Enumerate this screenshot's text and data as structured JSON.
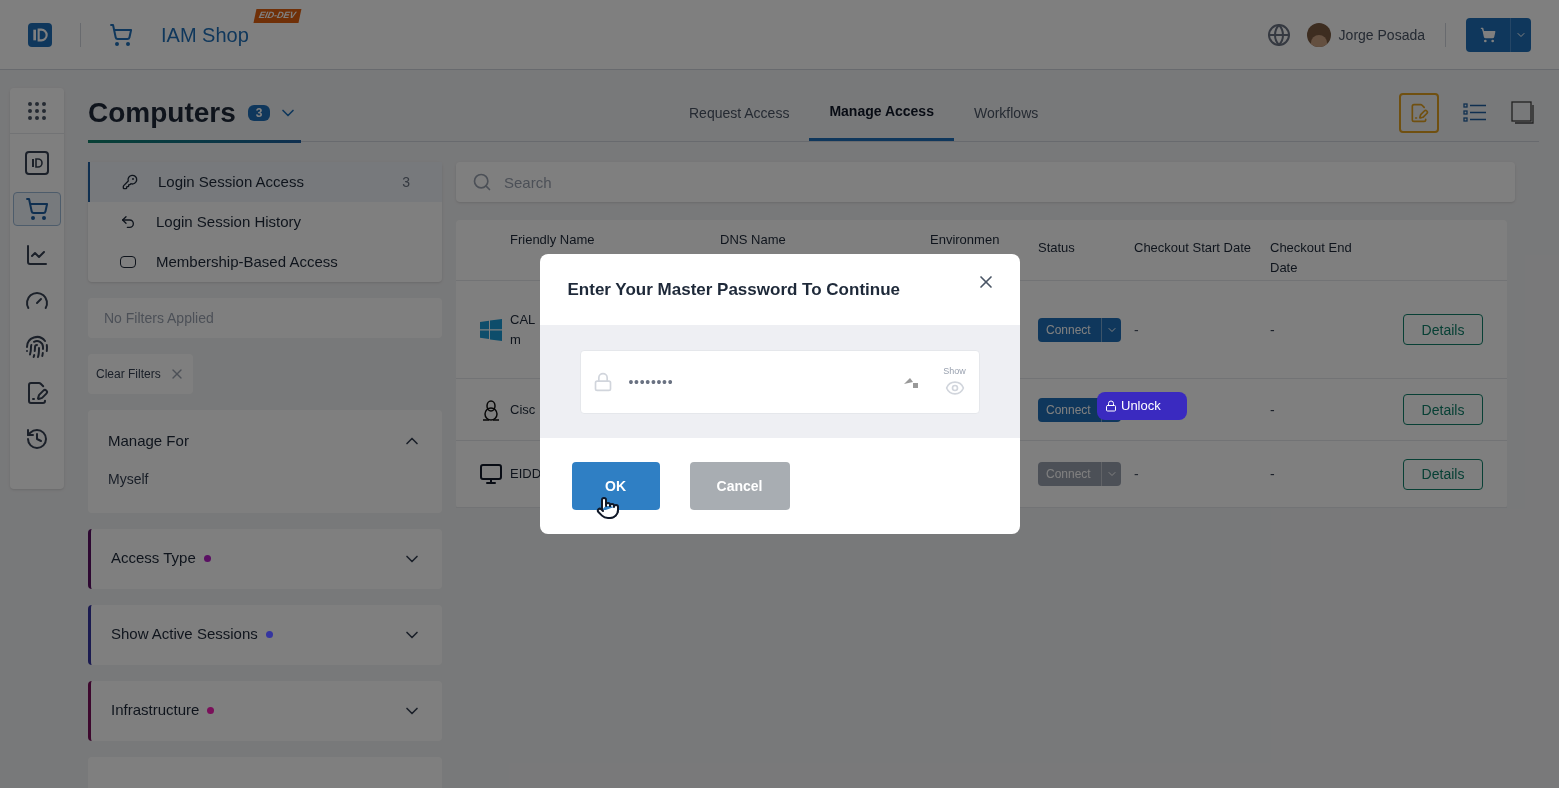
{
  "header": {
    "app_title": "IAM Shop",
    "env_badge": "EID-DEV",
    "user_name": "Jorge Posada"
  },
  "page": {
    "title": "Computers",
    "count": "3",
    "tabs": [
      {
        "label": "Request Access",
        "selected": false
      },
      {
        "label": "Manage Access",
        "selected": true
      },
      {
        "label": "Workflows",
        "selected": false
      }
    ]
  },
  "rail": {
    "items": [
      {
        "kind": "id",
        "selected": false
      },
      {
        "kind": "cart",
        "selected": true
      },
      {
        "kind": "chart",
        "selected": false
      },
      {
        "kind": "gauge",
        "selected": false
      },
      {
        "kind": "fingerprint",
        "selected": false
      },
      {
        "kind": "form",
        "selected": false
      },
      {
        "kind": "history",
        "selected": false
      }
    ]
  },
  "side_nav": [
    {
      "label": "Login Session Access",
      "count": "3",
      "selected": true
    },
    {
      "label": "Login Session History",
      "selected": false
    },
    {
      "label": "Membership-Based Access",
      "selected": false
    }
  ],
  "filters": {
    "summary": "No Filters Applied",
    "clear_label": "Clear Filters"
  },
  "filter_sections": [
    {
      "title": "Manage For",
      "expanded": true,
      "value": "Myself"
    },
    {
      "title": "Access Type",
      "expanded": false,
      "color": "#5a0f63"
    },
    {
      "title": "Show Active Sessions",
      "expanded": false,
      "color": "#3535a0"
    },
    {
      "title": "Infrastructure",
      "expanded": false,
      "color": "#7a0f5a"
    }
  ],
  "search": {
    "placeholder": "Search"
  },
  "table": {
    "columns": [
      "Friendly Name",
      "DNS Name",
      "Environmen",
      "Status",
      "Checkout Start Date",
      "Checkout End Date"
    ],
    "rows": [
      {
        "name_lines": [
          "CAL",
          "m"
        ],
        "status": "Connect",
        "disabled": false,
        "start": "-",
        "end": "-",
        "action": "Details"
      },
      {
        "name_lines": [
          "Cisc"
        ],
        "status": "Connect",
        "disabled": false,
        "end": "-",
        "action": "Details"
      },
      {
        "name_lines": [
          "EIDD"
        ],
        "status": "Connect",
        "disabled": true,
        "start": "-",
        "end": "-",
        "action": "Details"
      }
    ],
    "tooltip": {
      "label": "Unlock"
    }
  },
  "dialog": {
    "title": "Enter Your Master Password To Continue",
    "password": "••••••••",
    "show_label": "Show",
    "buttons": [
      {
        "label": "OK",
        "kind": "primary"
      },
      {
        "label": "Cancel",
        "kind": "secondary"
      }
    ]
  }
}
